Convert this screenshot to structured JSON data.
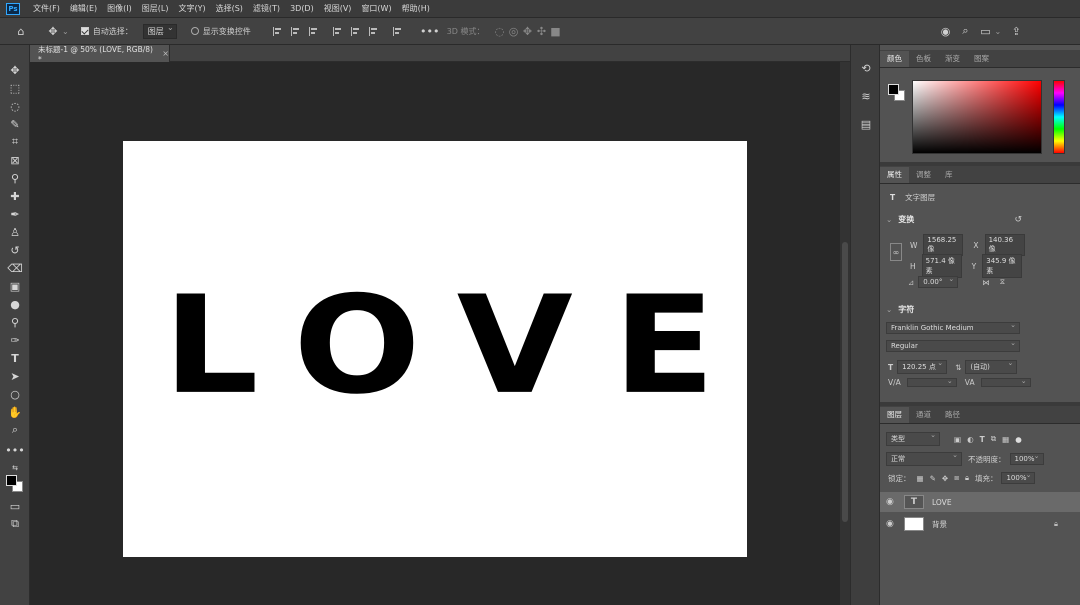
{
  "menubar": {
    "logo": "Ps",
    "items": [
      "文件(F)",
      "编辑(E)",
      "图像(I)",
      "图层(L)",
      "文字(Y)",
      "选择(S)",
      "滤镜(T)",
      "3D(D)",
      "视图(V)",
      "窗口(W)",
      "帮助(H)"
    ]
  },
  "options": {
    "auto_select_label": "自动选择：",
    "auto_select_value": "图层",
    "show_transform_label": "显示变换控件",
    "mode_3d": "3D 模式："
  },
  "tab": {
    "title": "未标题-1 @ 50% (LOVE, RGB/8) *",
    "close": "×"
  },
  "canvas": {
    "text": "LOVE",
    "background": "#ffffff",
    "text_color": "#000000"
  },
  "color_panel": {
    "tabs": [
      "颜色",
      "色板",
      "渐变",
      "图案"
    ],
    "fg": "#000000",
    "bg": "#ffffff"
  },
  "properties_panel": {
    "tabs": [
      "属性",
      "调整",
      "库"
    ],
    "layer_type": "文字图层",
    "transform_title": "变换",
    "w_label": "W",
    "w_value": "1568.25 像",
    "x_label": "X",
    "x_value": "140.36 像",
    "h_label": "H",
    "h_value": "571.4 像素",
    "y_label": "Y",
    "y_value": "345.9 像素",
    "angle_value": "0.00°",
    "character_title": "字符",
    "font_family": "Franklin Gothic Medium",
    "font_style": "Regular",
    "font_size": "120.25 点",
    "leading": "(自动)",
    "kerning_label": "V/A",
    "tracking_label": "VA"
  },
  "layers_panel": {
    "tabs": [
      "图层",
      "通道",
      "路径"
    ],
    "filter_label": "类型",
    "blend_mode": "正常",
    "opacity_label": "不透明度：",
    "opacity_value": "100%",
    "lock_label": "锁定：",
    "fill_label": "填充：",
    "fill_value": "100%",
    "layers": [
      {
        "name": "LOVE",
        "type": "text",
        "selected": true
      },
      {
        "name": "背景",
        "type": "background",
        "selected": false
      }
    ]
  }
}
